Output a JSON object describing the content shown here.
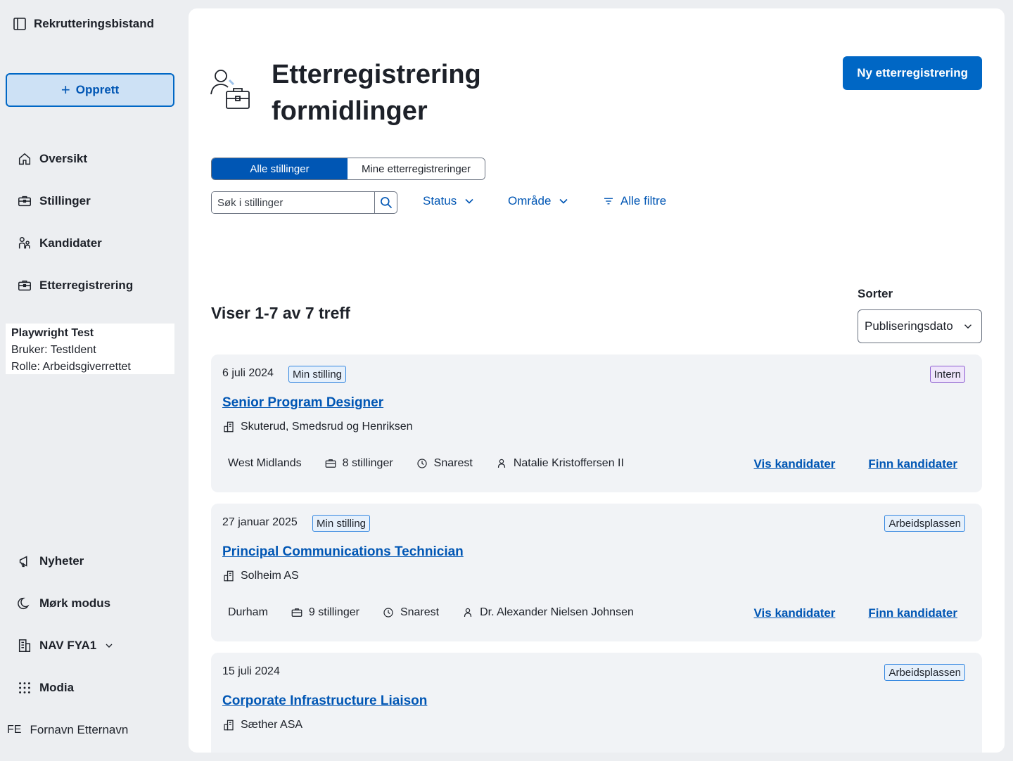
{
  "app": {
    "title": "Rekrutteringsbistand"
  },
  "sidebar": {
    "create_label": "Opprett",
    "nav": [
      {
        "label": "Oversikt",
        "icon": "house-icon"
      },
      {
        "label": "Stillinger",
        "icon": "briefcase-icon"
      },
      {
        "label": "Kandidater",
        "icon": "persons-icon"
      },
      {
        "label": "Etterregistrering",
        "icon": "briefcase-icon"
      }
    ],
    "user_info": {
      "name": "Playwright Test",
      "user_line": "Bruker: TestIdent",
      "role_line": "Rolle: Arbeidsgiverrettet"
    },
    "bottom_nav": [
      {
        "label": "Nyheter",
        "icon": "megaphone-icon"
      },
      {
        "label": "Mørk modus",
        "icon": "moon-icon"
      },
      {
        "label": "NAV FYA1",
        "icon": "buildings-icon"
      },
      {
        "label": "Modia",
        "icon": "grid-icon"
      }
    ],
    "account": {
      "initials": "FE",
      "name": "Fornavn Etternavn"
    }
  },
  "header": {
    "title_line1": "Etterregistrering",
    "title_line2": "formidlinger",
    "new_button": "Ny etterregistrering"
  },
  "toggle": {
    "all": "Alle stillinger",
    "mine": "Mine etterregistreringer"
  },
  "search": {
    "placeholder": "Søk i stillinger"
  },
  "filters": {
    "status": "Status",
    "area": "Område",
    "all": "Alle filtre"
  },
  "results": {
    "count_text": "Viser 1-7 av 7 treff"
  },
  "sort": {
    "label": "Sorter",
    "value": "Publiseringsdato"
  },
  "cards": [
    {
      "date": "6 juli 2024",
      "mine_tag": "Min stilling",
      "source_tag": "Intern",
      "title": "Senior Program Designer",
      "employer": "Skuterud, Smedsrud og Henriksen",
      "location": "West Midlands",
      "positions": "8 stillinger",
      "deadline": "Snarest",
      "owner": "Natalie Kristoffersen II",
      "link1": "Vis kandidater",
      "link2": "Finn kandidater"
    },
    {
      "date": "27 januar 2025",
      "mine_tag": "Min stilling",
      "source_tag": "Arbeidsplassen",
      "title": "Principal Communications Technician",
      "employer": "Solheim AS",
      "location": "Durham",
      "positions": "9 stillinger",
      "deadline": "Snarest",
      "owner": "Dr. Alexander Nielsen Johnsen",
      "link1": "Vis kandidater",
      "link2": "Finn kandidater"
    },
    {
      "date": "15 juli 2024",
      "source_tag": "Arbeidsplassen",
      "title": "Corporate Infrastructure Liaison",
      "employer": "Sæther ASA"
    }
  ],
  "colors": {
    "accent": "#0067c5",
    "link": "#0056b4",
    "card_bg": "#f1f3f6",
    "intern_tag": "#efe6fb"
  }
}
